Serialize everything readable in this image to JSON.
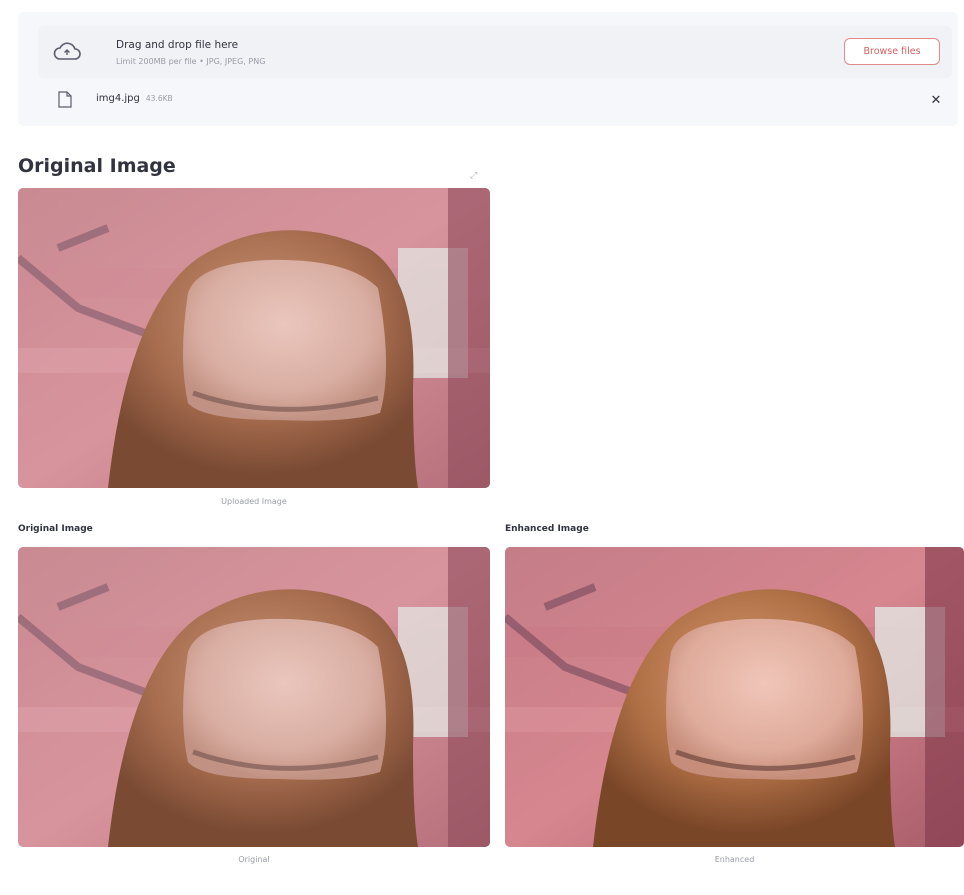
{
  "uploader": {
    "dropzone_title": "Drag and drop file here",
    "dropzone_subtitle": "Limit 200MB per file • JPG, JPEG, PNG",
    "browse_label": "Browse files",
    "icon": "cloud-upload-icon",
    "file": {
      "name": "img4.jpg",
      "size": "43.6KB",
      "icon": "file-icon",
      "remove_icon": "close-icon"
    }
  },
  "main": {
    "title": "Original Image",
    "uploaded_caption": "Uploaded Image",
    "columns": [
      {
        "title": "Original Image",
        "caption": "Original"
      },
      {
        "title": "Enhanced Image",
        "caption": "Enhanced"
      }
    ]
  },
  "colors": {
    "accent": "#d26161",
    "text": "#31333f",
    "muted": "#9a9ca6",
    "uploader_bg": "#f0f2f6"
  }
}
